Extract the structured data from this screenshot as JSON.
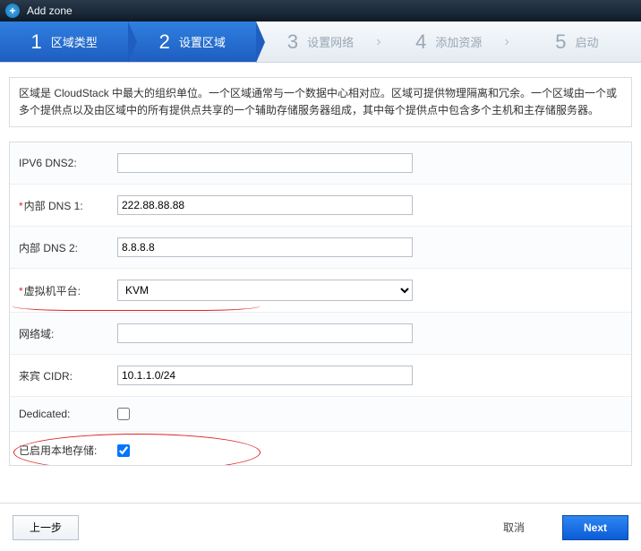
{
  "title": "Add zone",
  "wizard": {
    "steps": [
      {
        "num": "1",
        "label": "区域类型"
      },
      {
        "num": "2",
        "label": "设置区域"
      },
      {
        "num": "3",
        "label": "设置网络"
      },
      {
        "num": "4",
        "label": "添加资源"
      },
      {
        "num": "5",
        "label": "启动"
      }
    ],
    "active_index": 1
  },
  "description": "区域是 CloudStack 中最大的组织单位。一个区域通常与一个数据中心相对应。区域可提供物理隔离和冗余。一个区域由一个或多个提供点以及由区域中的所有提供点共享的一个辅助存储服务器组成，其中每个提供点中包含多个主机和主存储服务器。",
  "form": {
    "ipv6_dns2": {
      "label": "IPV6 DNS2:",
      "value": "",
      "required": false
    },
    "internal_dns1": {
      "label": "内部 DNS 1:",
      "value": "222.88.88.88",
      "required": true
    },
    "internal_dns2": {
      "label": "内部 DNS 2:",
      "value": "8.8.8.8",
      "required": false
    },
    "hypervisor": {
      "label": "虚拟机平台:",
      "value": "KVM",
      "required": true
    },
    "network_domain": {
      "label": "网络域:",
      "value": "",
      "required": false
    },
    "guest_cidr": {
      "label": "来宾 CIDR:",
      "value": "10.1.1.0/24",
      "required": false
    },
    "dedicated": {
      "label": "Dedicated:",
      "checked": false
    },
    "local_storage": {
      "label": "已启用本地存储:",
      "checked": true
    }
  },
  "footer": {
    "prev": "上一步",
    "cancel": "取消",
    "next": "Next"
  }
}
